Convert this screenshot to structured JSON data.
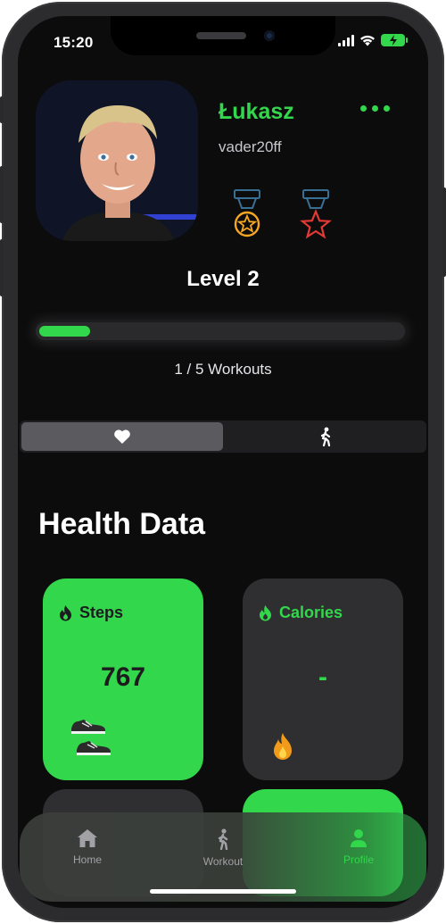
{
  "status_bar": {
    "time": "15:20"
  },
  "profile": {
    "name": "Łukasz",
    "handle": "vader20ff",
    "level": "Level 2",
    "progress_fraction": 0.14,
    "workouts_text": "1 / 5 Workouts"
  },
  "badges": [
    {
      "icon": "gold-star-medal-icon",
      "color": "#f5a623"
    },
    {
      "icon": "red-star-medal-icon",
      "color": "#e53935"
    }
  ],
  "segments": [
    {
      "icon": "heart-icon",
      "active": true
    },
    {
      "icon": "walking-person-icon",
      "active": false
    }
  ],
  "section_title": "Health Data",
  "cards": {
    "steps": {
      "title": "Steps",
      "value": "767",
      "icon": "flame-icon"
    },
    "calories": {
      "title": "Calories",
      "value": "-",
      "icon": "flame-icon"
    }
  },
  "tabbar": {
    "home": "Home",
    "workout": "Workout",
    "profile": "Profile"
  },
  "colors": {
    "accent": "#32d74b",
    "background": "#0c0c0d",
    "card_dark": "#2f2f31"
  }
}
